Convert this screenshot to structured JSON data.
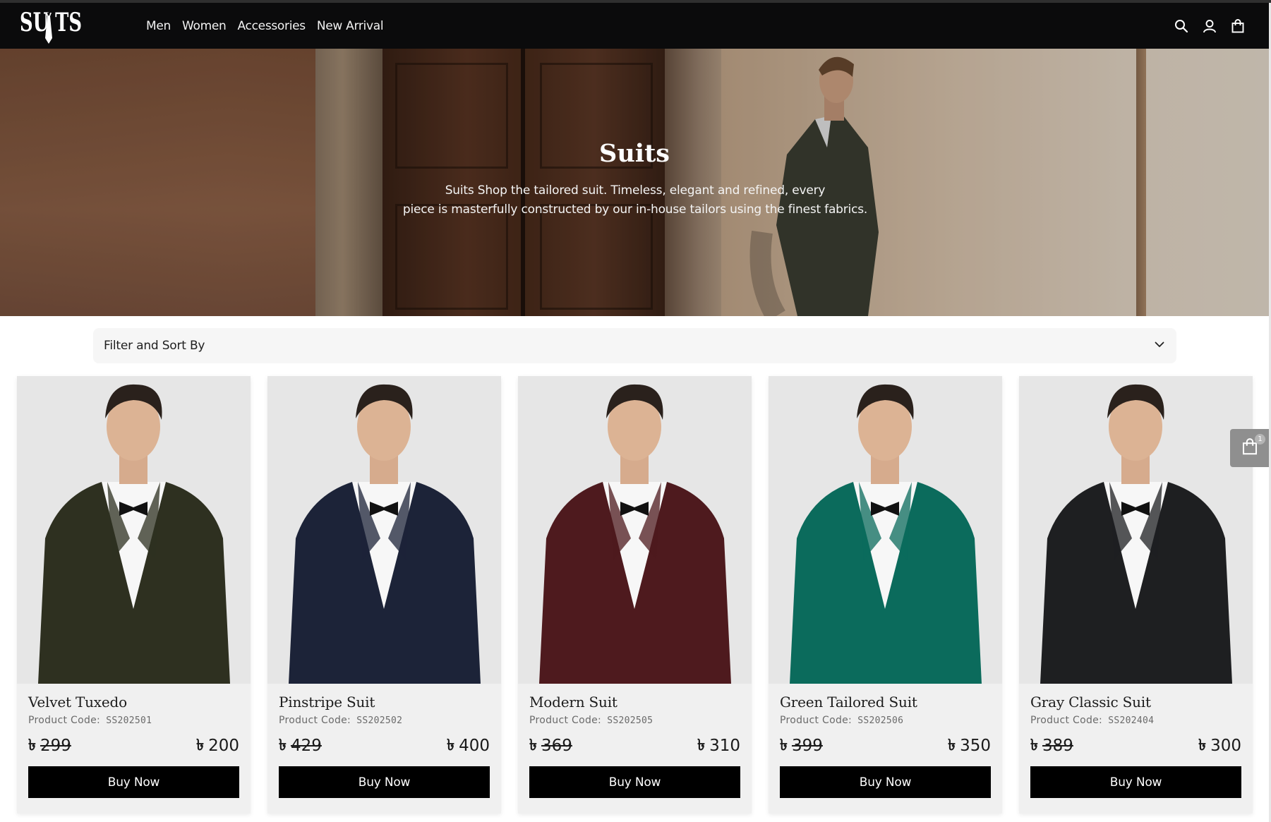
{
  "brand": {
    "logo_text": "SUITS"
  },
  "nav": {
    "items": [
      {
        "label": "Men"
      },
      {
        "label": "Women"
      },
      {
        "label": "Accessories"
      },
      {
        "label": "New Arrival"
      }
    ]
  },
  "header_icons": [
    "search-icon",
    "user-icon",
    "shopping-bag-icon"
  ],
  "hero": {
    "title": "Suits",
    "description_line1": "Suits Shop the tailored suit. Timeless, elegant and refined, every",
    "description_line2": "piece is masterfully constructed by our in-house tailors using the finest fabrics."
  },
  "filter": {
    "label": "Filter and Sort By",
    "icon": "chevron-down-icon"
  },
  "currency_symbol": "৳",
  "products": [
    {
      "name": "Velvet Tuxedo",
      "code_label": "Product Code:",
      "code": "SS202501",
      "old_price": "299",
      "price": "200",
      "button": "Buy Now",
      "jacket_color": "#2e3020"
    },
    {
      "name": "Pinstripe Suit",
      "code_label": "Product Code:",
      "code": "SS202502",
      "old_price": "429",
      "price": "400",
      "button": "Buy Now",
      "jacket_color": "#1c2338"
    },
    {
      "name": "Modern Suit",
      "code_label": "Product Code:",
      "code": "SS202505",
      "old_price": "369",
      "price": "310",
      "button": "Buy Now",
      "jacket_color": "#4e1a1e"
    },
    {
      "name": "Green Tailored Suit",
      "code_label": "Product Code:",
      "code": "SS202506",
      "old_price": "399",
      "price": "350",
      "button": "Buy Now",
      "jacket_color": "#0b6b5c"
    },
    {
      "name": "Gray Classic Suit",
      "code_label": "Product Code:",
      "code": "SS202404",
      "old_price": "389",
      "price": "300",
      "button": "Buy Now",
      "jacket_color": "#1e1f21"
    }
  ],
  "floating_cart": {
    "count": "1",
    "icon": "shopping-bag-icon"
  },
  "colors": {
    "header_bg": "#0b0b0c",
    "button_bg": "#000000",
    "card_bg": "#f0f0f0"
  }
}
